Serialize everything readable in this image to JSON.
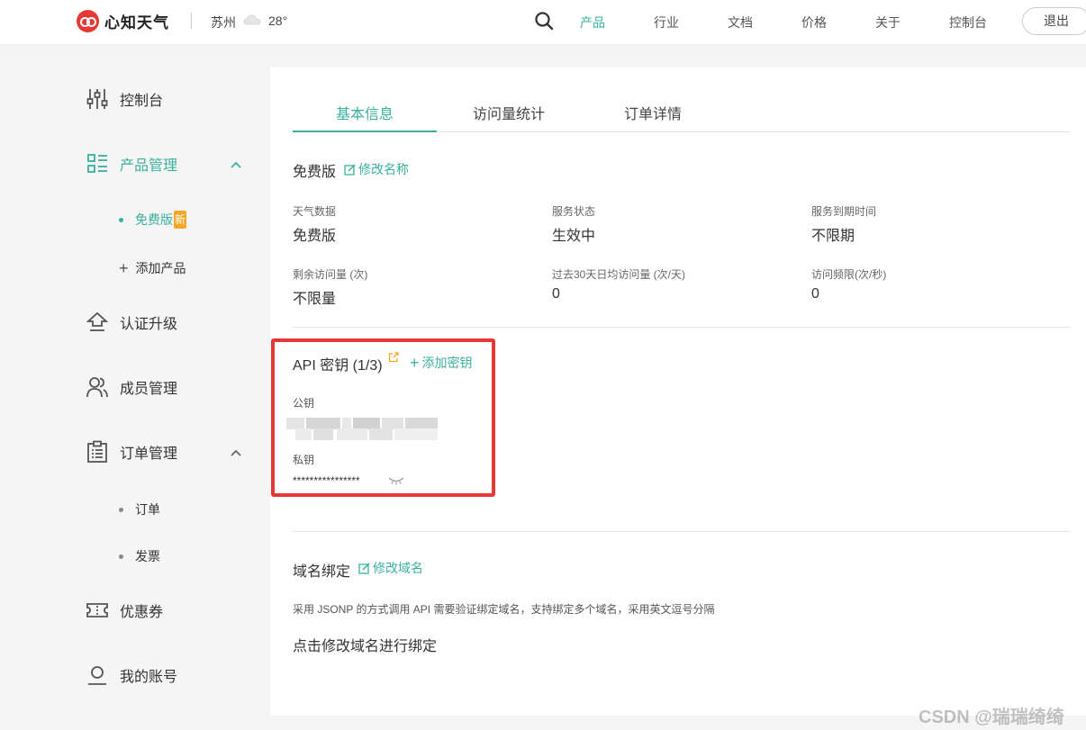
{
  "header": {
    "brand": "心知天气",
    "city": "苏州",
    "temperature": "28°",
    "weather_icon": "cloud-icon",
    "nav": [
      {
        "label": "产品"
      },
      {
        "label": "行业"
      },
      {
        "label": "文档"
      },
      {
        "label": "价格"
      },
      {
        "label": "关于"
      },
      {
        "label": "控制台"
      }
    ],
    "logout_label": "退出",
    "accent_color": "#3ab09e"
  },
  "sidebar": {
    "items": {
      "console": "控制台",
      "product_mgmt": "产品管理",
      "free_plan": "免费版",
      "new_badge": "新",
      "add_product": "添加产品",
      "verify_upgrade": "认证升级",
      "member_mgmt": "成员管理",
      "order_mgmt": "订单管理",
      "orders": "订单",
      "invoice": "发票",
      "coupons": "优惠券",
      "my_account": "我的账号"
    }
  },
  "tabs": [
    {
      "label": "基本信息",
      "active": true
    },
    {
      "label": "访问量统计",
      "active": false
    },
    {
      "label": "订单详情",
      "active": false
    }
  ],
  "plan": {
    "name": "免费版",
    "rename_label": "修改名称",
    "fields": [
      {
        "label": "天气数据",
        "value": "免费版"
      },
      {
        "label": "服务状态",
        "value": "生效中"
      },
      {
        "label": "服务到期时间",
        "value": "不限期"
      },
      {
        "label": "剩余访问量 (次)",
        "value": "不限量"
      },
      {
        "label": "过去30天日均访问量 (次/天)",
        "value": "0"
      },
      {
        "label": "访问频限(次/秒)",
        "value": "0"
      }
    ]
  },
  "api": {
    "title": "API 密钥 (1/3)",
    "add_label": "添加密钥",
    "public_key_label": "公钥",
    "private_key_label": "私钥",
    "private_key_value": "****************"
  },
  "domain": {
    "title": "域名绑定",
    "edit_label": "修改域名",
    "description": "采用 JSONP 的方式调用 API 需要验证绑定域名，支持绑定多个域名，采用英文逗号分隔",
    "action": "点击修改域名进行绑定"
  },
  "watermark": "CSDN @瑞瑞绮绮"
}
